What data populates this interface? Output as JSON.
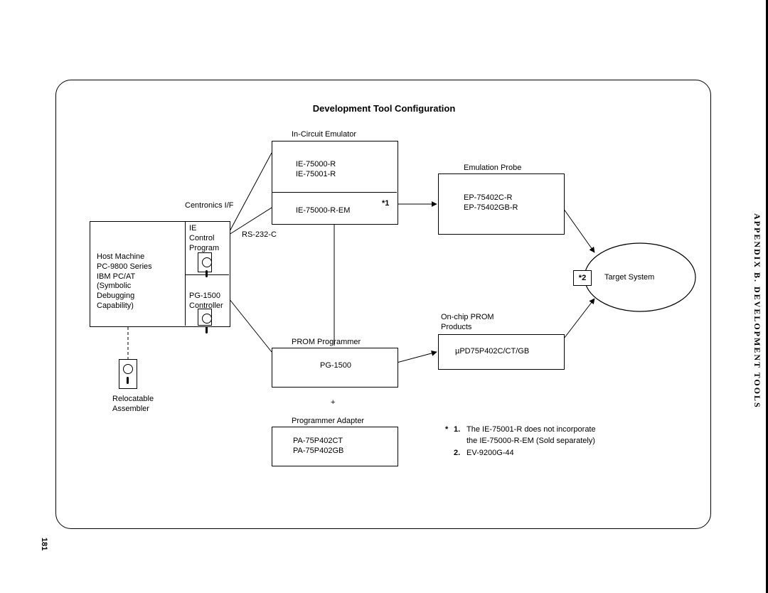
{
  "page": {
    "appendix_label": "APPENDIX B.  DEVELOPMENT TOOLS",
    "page_number": "181"
  },
  "diagram": {
    "title": "Development Tool Configuration",
    "host_machine": "Host Machine\nPC-9800 Series\nIBM PC/AT\n(Symbolic\nDebugging\nCapability)",
    "ie_control": "IE\nControl\nProgram",
    "pg_controller": "PG-1500\nController",
    "centronics": "Centronics I/F",
    "rs232": "RS-232-C",
    "reloc_asm": "Relocatable\nAssembler",
    "emulator_label": "In-Circuit Emulator",
    "emulator_top": "IE-75000-R\nIE-75001-R",
    "emulator_bottom": "IE-75000-R-EM",
    "ref1": "*1",
    "prom_prog_label": "PROM Programmer",
    "prom_prog": "PG-1500",
    "plus": "+",
    "adapter_label": "Programmer Adapter",
    "adapter": "PA-75P402CT\nPA-75P402GB",
    "emu_probe_label": "Emulation Probe",
    "emu_probe": "EP-75402C-R\nEP-75402GB-R",
    "onchip_label": "On-chip PROM\nProducts",
    "onchip": "µPD75P402C/CT/GB",
    "ref2": "*2",
    "target": "Target System",
    "note_star": "*",
    "note1b": "1.",
    "note1": "The IE-75001-R does not incorporate",
    "note1c": "the IE-75000-R-EM (Sold separately)",
    "note2b": "2.",
    "note2": "EV-9200G-44"
  }
}
